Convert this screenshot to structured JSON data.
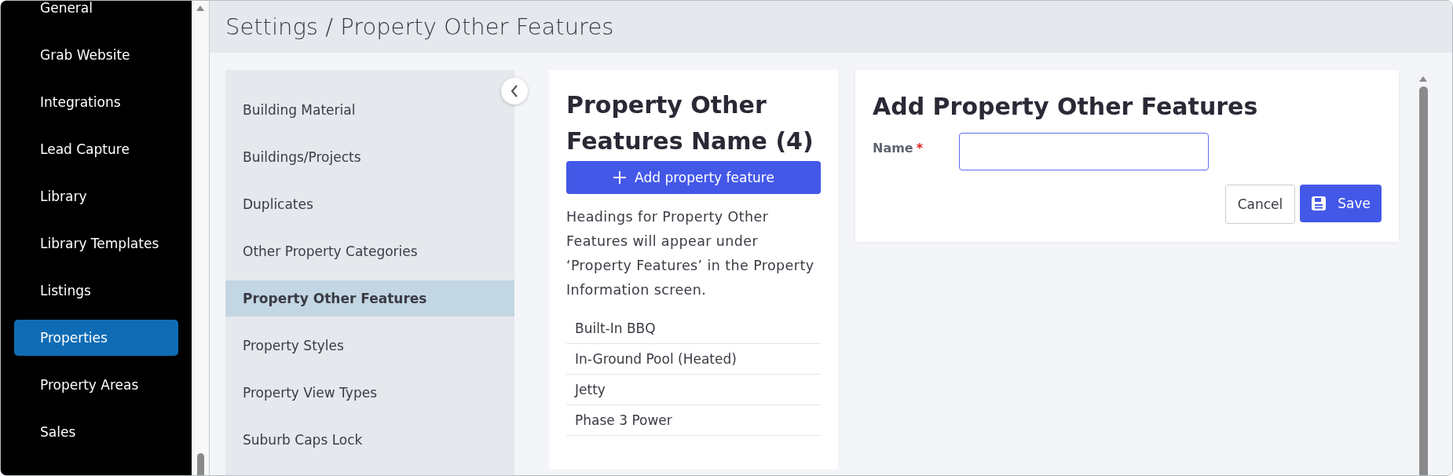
{
  "nav": {
    "items": [
      {
        "label": "General",
        "selected": false
      },
      {
        "label": "Grab Website",
        "selected": false
      },
      {
        "label": "Integrations",
        "selected": false
      },
      {
        "label": "Lead Capture",
        "selected": false
      },
      {
        "label": "Library",
        "selected": false
      },
      {
        "label": "Library Templates",
        "selected": false
      },
      {
        "label": "Listings",
        "selected": false
      },
      {
        "label": "Properties",
        "selected": true
      },
      {
        "label": "Property Areas",
        "selected": false
      },
      {
        "label": "Sales",
        "selected": false
      }
    ]
  },
  "header": {
    "title": "Settings / Property Other Features"
  },
  "subnav": {
    "items": [
      {
        "label": "Building Material",
        "selected": false
      },
      {
        "label": "Buildings/Projects",
        "selected": false
      },
      {
        "label": "Duplicates",
        "selected": false
      },
      {
        "label": "Other Property Categories",
        "selected": false
      },
      {
        "label": "Property Other Features",
        "selected": true
      },
      {
        "label": "Property Styles",
        "selected": false
      },
      {
        "label": "Property View Types",
        "selected": false
      },
      {
        "label": "Suburb Caps Lock",
        "selected": false
      }
    ]
  },
  "list_card": {
    "title": "Property Other Features Name (4)",
    "add_button": "Add property feature",
    "description": "Headings for Property Other Features will appear under ‘Property Features’ in the Property Information screen.",
    "features": [
      "Built-In BBQ",
      "In-Ground Pool (Heated)",
      "Jetty",
      "Phase 3 Power"
    ]
  },
  "form_card": {
    "title": "Add Property Other Features",
    "fields": [
      {
        "label": "Name",
        "required": true,
        "required_mark": "*"
      }
    ],
    "buttons": [
      {
        "label": "Cancel",
        "kind": "secondary"
      },
      {
        "label": "Save",
        "kind": "primary"
      }
    ]
  }
}
